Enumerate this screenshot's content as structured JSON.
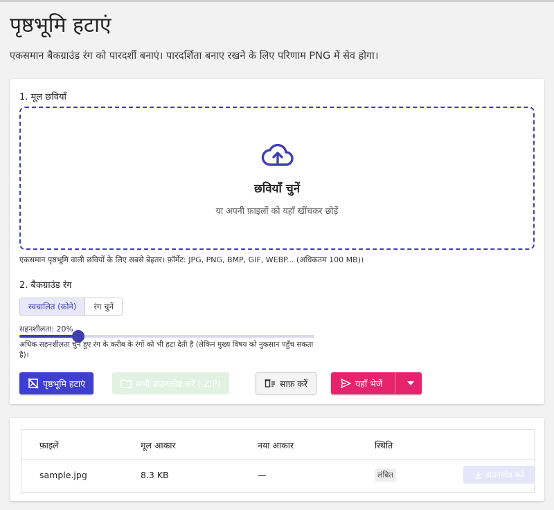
{
  "page": {
    "title": "पृष्ठभूमि हटाएं",
    "description": "एकसमान बैकग्राउंड रंग को पारदर्शी बनाएं। पारदर्शिता बनाए रखने के लिए परिणाम PNG में सेव होगा।"
  },
  "source": {
    "section_label": "1. मूल छवियाँ",
    "dropzone_title": "छवियाँ चुनें",
    "dropzone_subtitle": "या अपनी फ़ाइलों को यहाँ खींचकर छोड़ें",
    "hint": "एकसमान पृष्ठभूमि वाली छवियों के लिए सबसे बेहतर। फ़ॉर्मेट: JPG, PNG, BMP, GIF, WEBP... (अधिकतम 100 MB)।",
    "upload_icon": "cloud-upload-icon"
  },
  "background": {
    "section_label": "2. बैकग्राउंड रंग",
    "modes": [
      "स्वचालित (कोने)",
      "रंग चुनें"
    ],
    "active_mode": 0,
    "tolerance_label": "सहनशीलता: 20%",
    "tolerance_value": 0.2,
    "tolerance_note": "अधिक सहनशीलता चुने हुए रंग के करीब के रंगों को भी हटा देती है (लेकिन मुख्य विषय को नुकसान पहुँच सकता है)।"
  },
  "actions": {
    "remove_bg": "पृष्ठभूमि हटाएं",
    "download_all": "सभी डाउनलोड करें (.ZIP)",
    "clear": "साफ़ करें",
    "send_here": "यहाँ भेजें"
  },
  "table": {
    "headers": [
      "फ़ाइलें",
      "मूल आकार",
      "नया आकार",
      "स्थिति"
    ],
    "rows": [
      {
        "file": "sample.jpg",
        "original_size": "8.3 KB",
        "new_size": "—",
        "status": "लंबित",
        "download": "डाउनलोड करें"
      }
    ]
  },
  "colors": {
    "primary": "#3f3fcf",
    "accent_pink": "#e8236d",
    "dropzone_border": "#3f3fb3"
  }
}
